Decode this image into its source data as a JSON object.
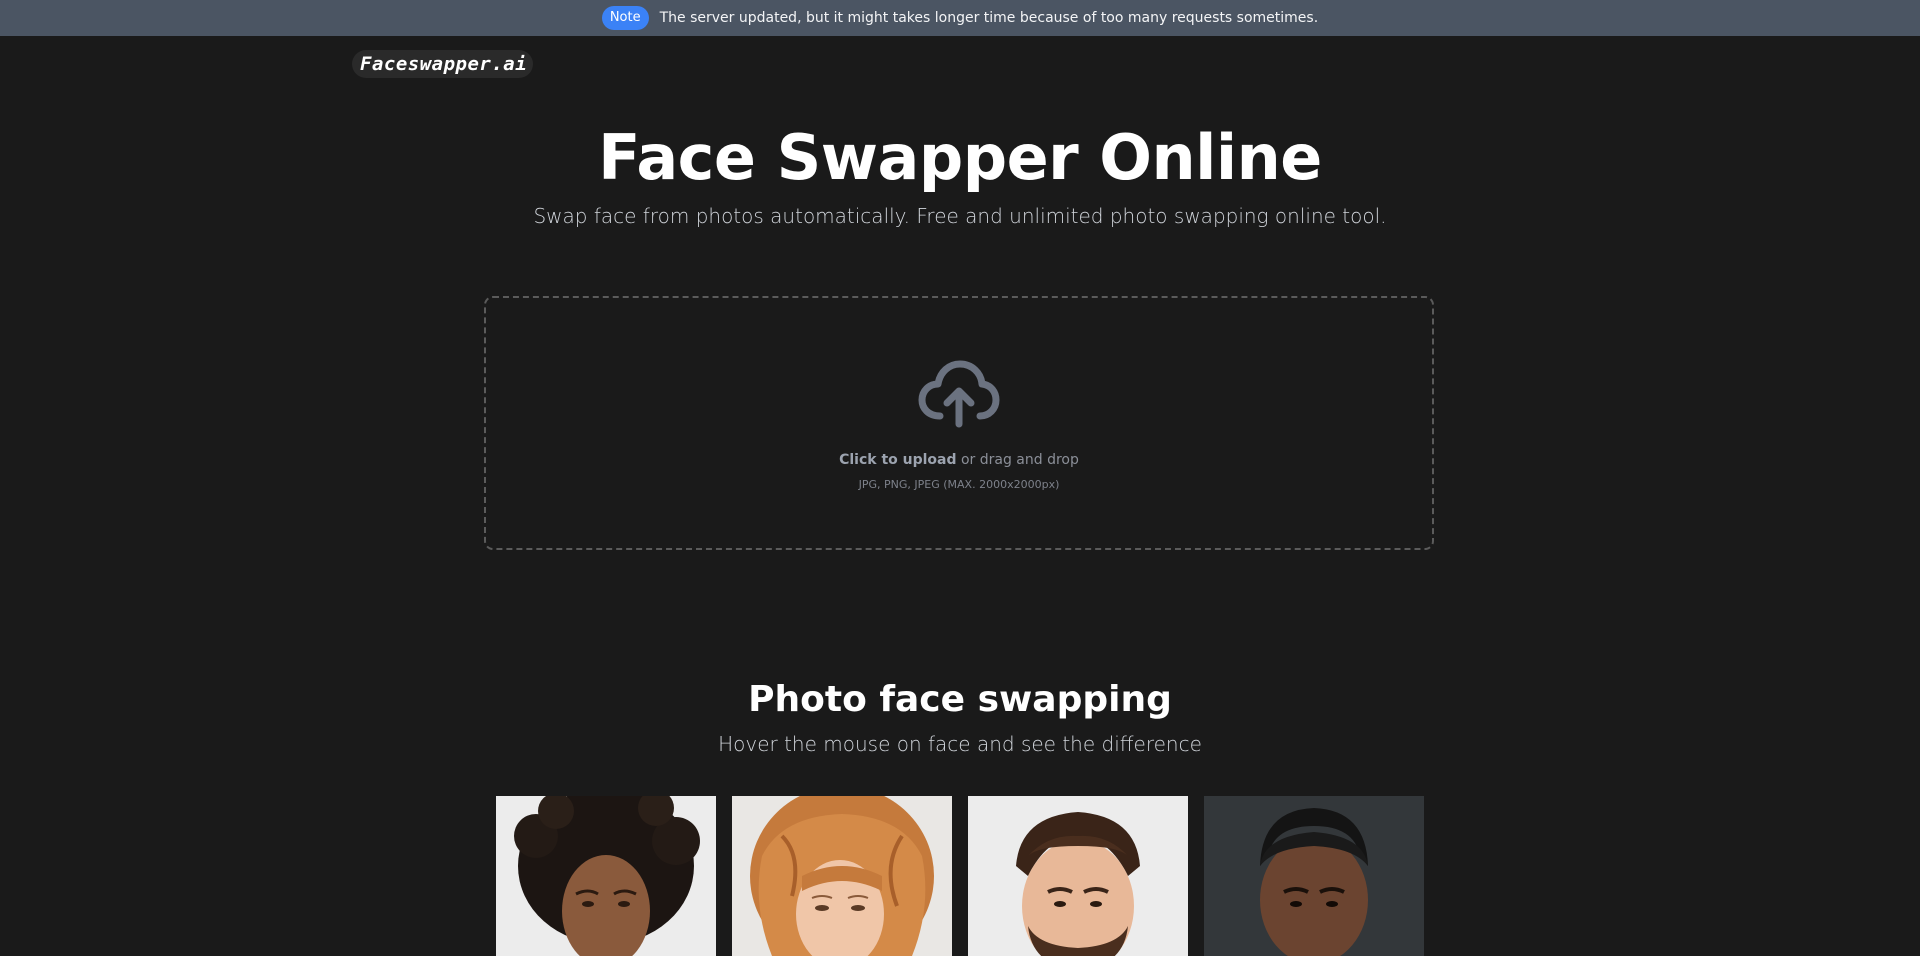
{
  "banner": {
    "badge": "Note",
    "message": "The server updated, but it might takes longer time because of too many requests sometimes."
  },
  "header": {
    "logo": "Faceswapper.ai"
  },
  "hero": {
    "title": "Face Swapper Online",
    "subtitle": "Swap face from photos automatically. Free and unlimited photo swapping online tool."
  },
  "upload": {
    "icon": "cloud-upload-icon",
    "click_label": "Click to upload",
    "rest_label": " or drag and drop",
    "formats": "JPG, PNG, JPEG (MAX. 2000x2000px)"
  },
  "section": {
    "title": "Photo face swapping",
    "subtitle": "Hover the mouse on face and see the difference"
  },
  "gallery": {
    "photos": [
      "face-photo-1",
      "face-photo-2",
      "face-photo-3",
      "face-photo-4"
    ]
  },
  "colors": {
    "background": "#1a1a1a",
    "banner": "#4b5563",
    "badge": "#3b82f6"
  }
}
